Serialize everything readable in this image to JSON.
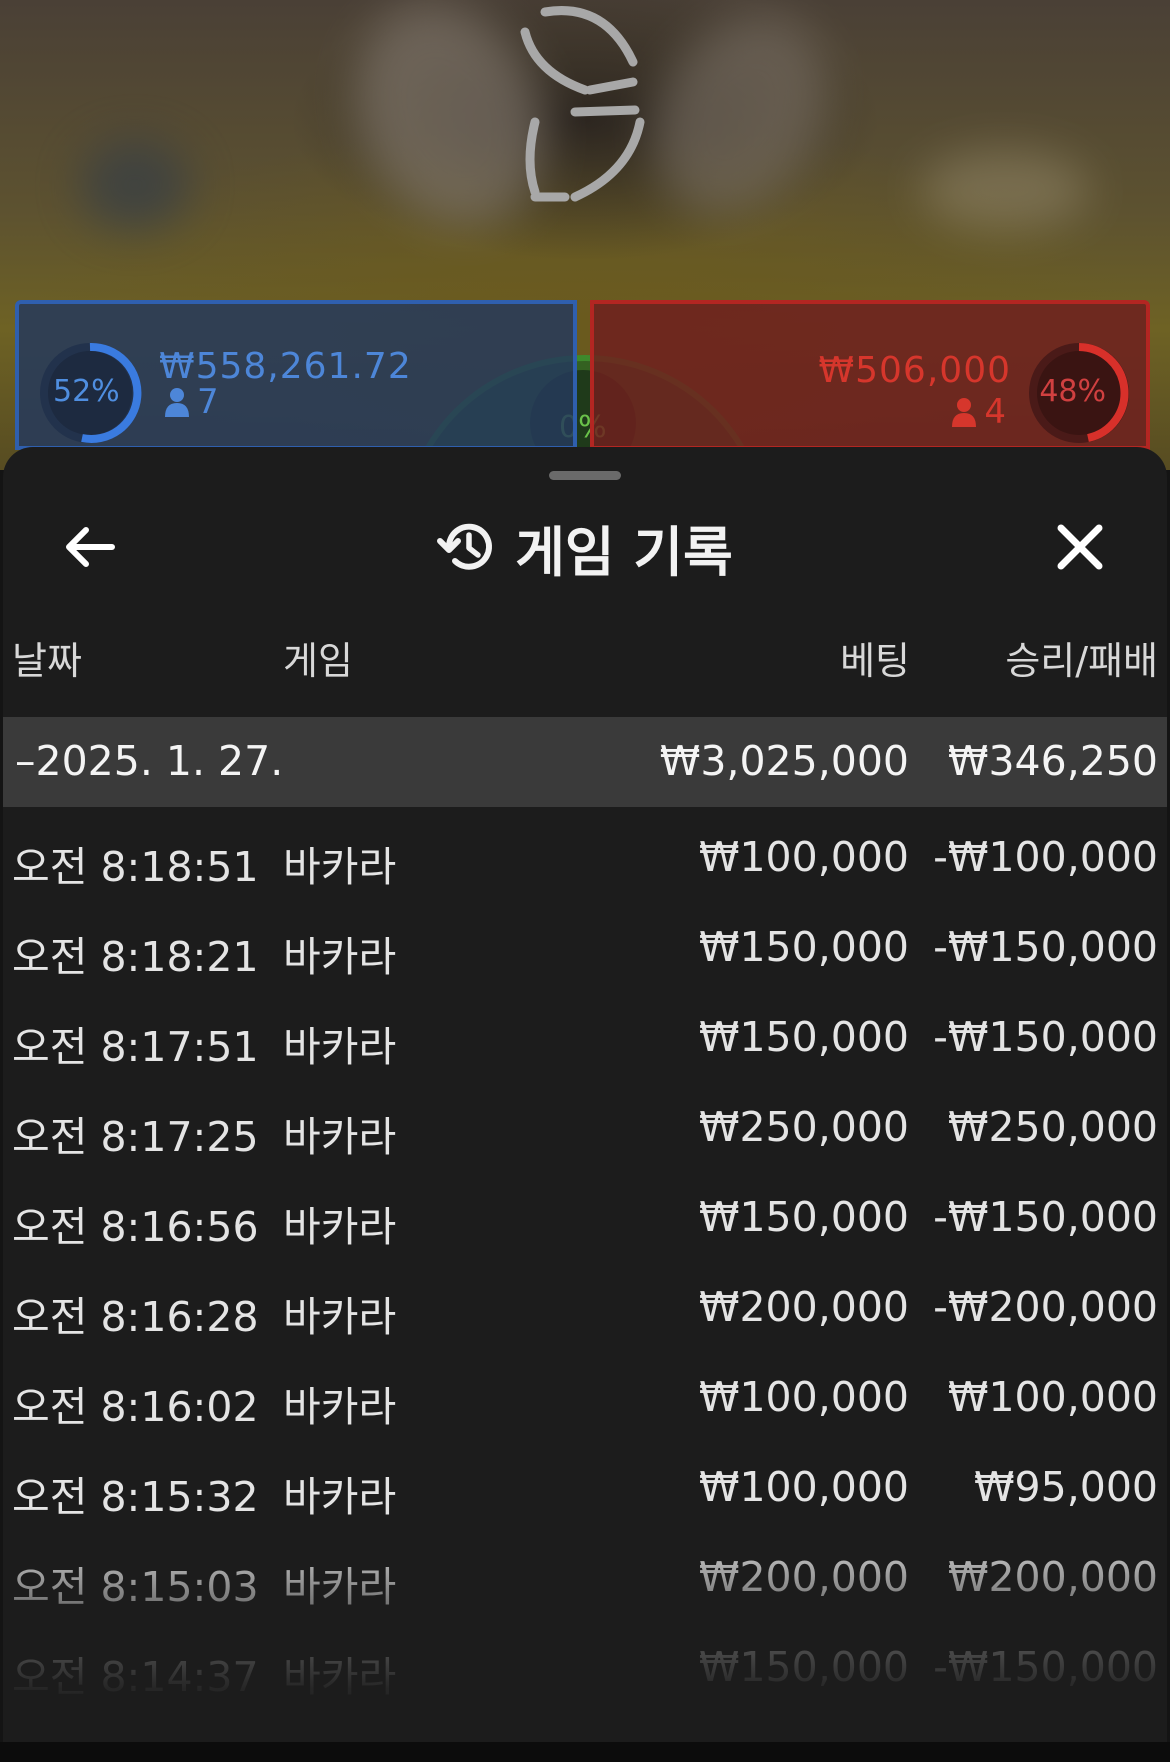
{
  "game_background": {
    "player": {
      "percent": "52%",
      "amount": "₩558,261.72",
      "count": "7",
      "color": "#2f5fae"
    },
    "tie": {
      "percent": "0%",
      "color": "#3e8a2c"
    },
    "banker": {
      "percent": "48%",
      "amount": "₩506,000",
      "count": "4",
      "color": "#b32622"
    }
  },
  "sheet": {
    "title": "게임 기록",
    "back_icon": "arrow-left-icon",
    "close_icon": "close-icon",
    "history_icon": "history-icon"
  },
  "table": {
    "headers": {
      "date": "날짜",
      "game": "게임",
      "bet": "베팅",
      "win_loss": "승리/패배"
    },
    "summary": {
      "date": "–2025. 1. 27.",
      "bet": "₩3,025,000",
      "win_loss": "₩346,250"
    },
    "rows": [
      {
        "time": "오전 8:18:51",
        "game": "바카라",
        "bet": "₩100,000",
        "win_loss": "-₩100,000"
      },
      {
        "time": "오전 8:18:21",
        "game": "바카라",
        "bet": "₩150,000",
        "win_loss": "-₩150,000"
      },
      {
        "time": "오전 8:17:51",
        "game": "바카라",
        "bet": "₩150,000",
        "win_loss": "-₩150,000"
      },
      {
        "time": "오전 8:17:25",
        "game": "바카라",
        "bet": "₩250,000",
        "win_loss": "₩250,000"
      },
      {
        "time": "오전 8:16:56",
        "game": "바카라",
        "bet": "₩150,000",
        "win_loss": "-₩150,000"
      },
      {
        "time": "오전 8:16:28",
        "game": "바카라",
        "bet": "₩200,000",
        "win_loss": "-₩200,000"
      },
      {
        "time": "오전 8:16:02",
        "game": "바카라",
        "bet": "₩100,000",
        "win_loss": "₩100,000"
      },
      {
        "time": "오전 8:15:32",
        "game": "바카라",
        "bet": "₩100,000",
        "win_loss": "₩95,000"
      },
      {
        "time": "오전 8:15:03",
        "game": "바카라",
        "bet": "₩200,000",
        "win_loss": "₩200,000"
      },
      {
        "time": "오전 8:14:37",
        "game": "바카라",
        "bet": "₩150,000",
        "win_loss": "-₩150,000"
      }
    ]
  }
}
